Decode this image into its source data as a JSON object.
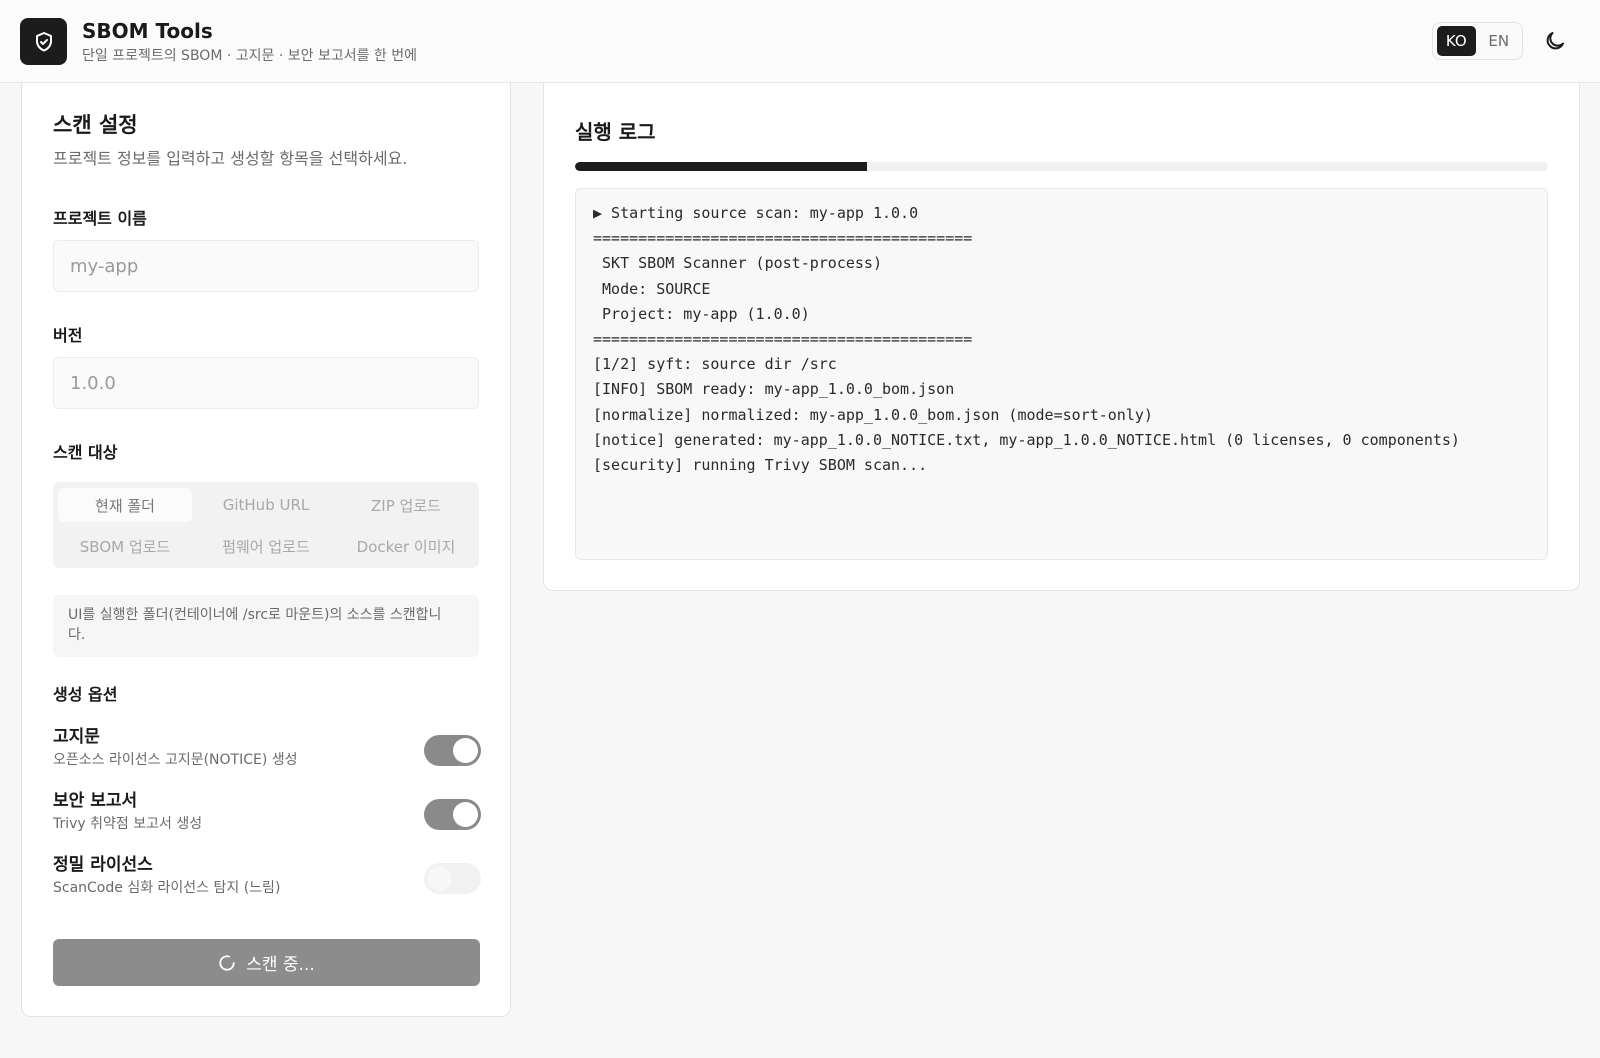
{
  "header": {
    "title": "SBOM Tools",
    "subtitle": "단일 프로젝트의 SBOM · 고지문 · 보안 보고서를 한 번에",
    "lang": [
      "KO",
      "EN"
    ],
    "active_lang": "KO",
    "logo_icon": "shield-check-icon",
    "theme_icon": "moon-icon"
  },
  "scan": {
    "title": "스캔 설정",
    "description": "프로젝트 정보를 입력하고 생성할 항목을 선택하세요.",
    "project_label": "프로젝트 이름",
    "project_placeholder": "my-app",
    "version_label": "버전",
    "version_placeholder": "1.0.0",
    "target_label": "스캔 대상",
    "targets": [
      "현재 폴더",
      "GitHub URL",
      "ZIP 업로드",
      "SBOM 업로드",
      "펌웨어 업로드",
      "Docker 이미지"
    ],
    "active_target": "현재 폴더",
    "target_note": "UI를 실행한 폴더(컨테이너에 /src로 마운트)의 소스를 스캔합니\n다.",
    "options_label": "생성 옵션",
    "options": [
      {
        "title": "고지문",
        "desc": "오픈소스 라이선스 고지문(NOTICE) 생성",
        "enabled": true
      },
      {
        "title": "보안 보고서",
        "desc": "Trivy 취약점 보고서 생성",
        "enabled": true
      },
      {
        "title": "정밀 라이선스",
        "desc": "ScanCode 심화 라이선스 탐지 (느림)",
        "enabled": false
      }
    ],
    "button_label": "스캔 중...",
    "button_icon": "spinner-icon"
  },
  "log": {
    "title": "실행 로그",
    "progress": 0.3,
    "lines": [
      "▶ Starting source scan: my-app 1.0.0",
      "==========================================",
      " SKT SBOM Scanner (post-process)",
      " Mode: SOURCE",
      " Project: my-app (1.0.0)",
      "==========================================",
      "[1/2] syft: source dir /src",
      "[INFO] SBOM ready: my-app_1.0.0_bom.json",
      "[normalize] normalized: my-app_1.0.0_bom.json (mode=sort-only)",
      "[notice] generated: my-app_1.0.0_NOTICE.txt, my-app_1.0.0_NOTICE.html (0 licenses, 0 components)",
      "[security] running Trivy SBOM scan..."
    ]
  }
}
